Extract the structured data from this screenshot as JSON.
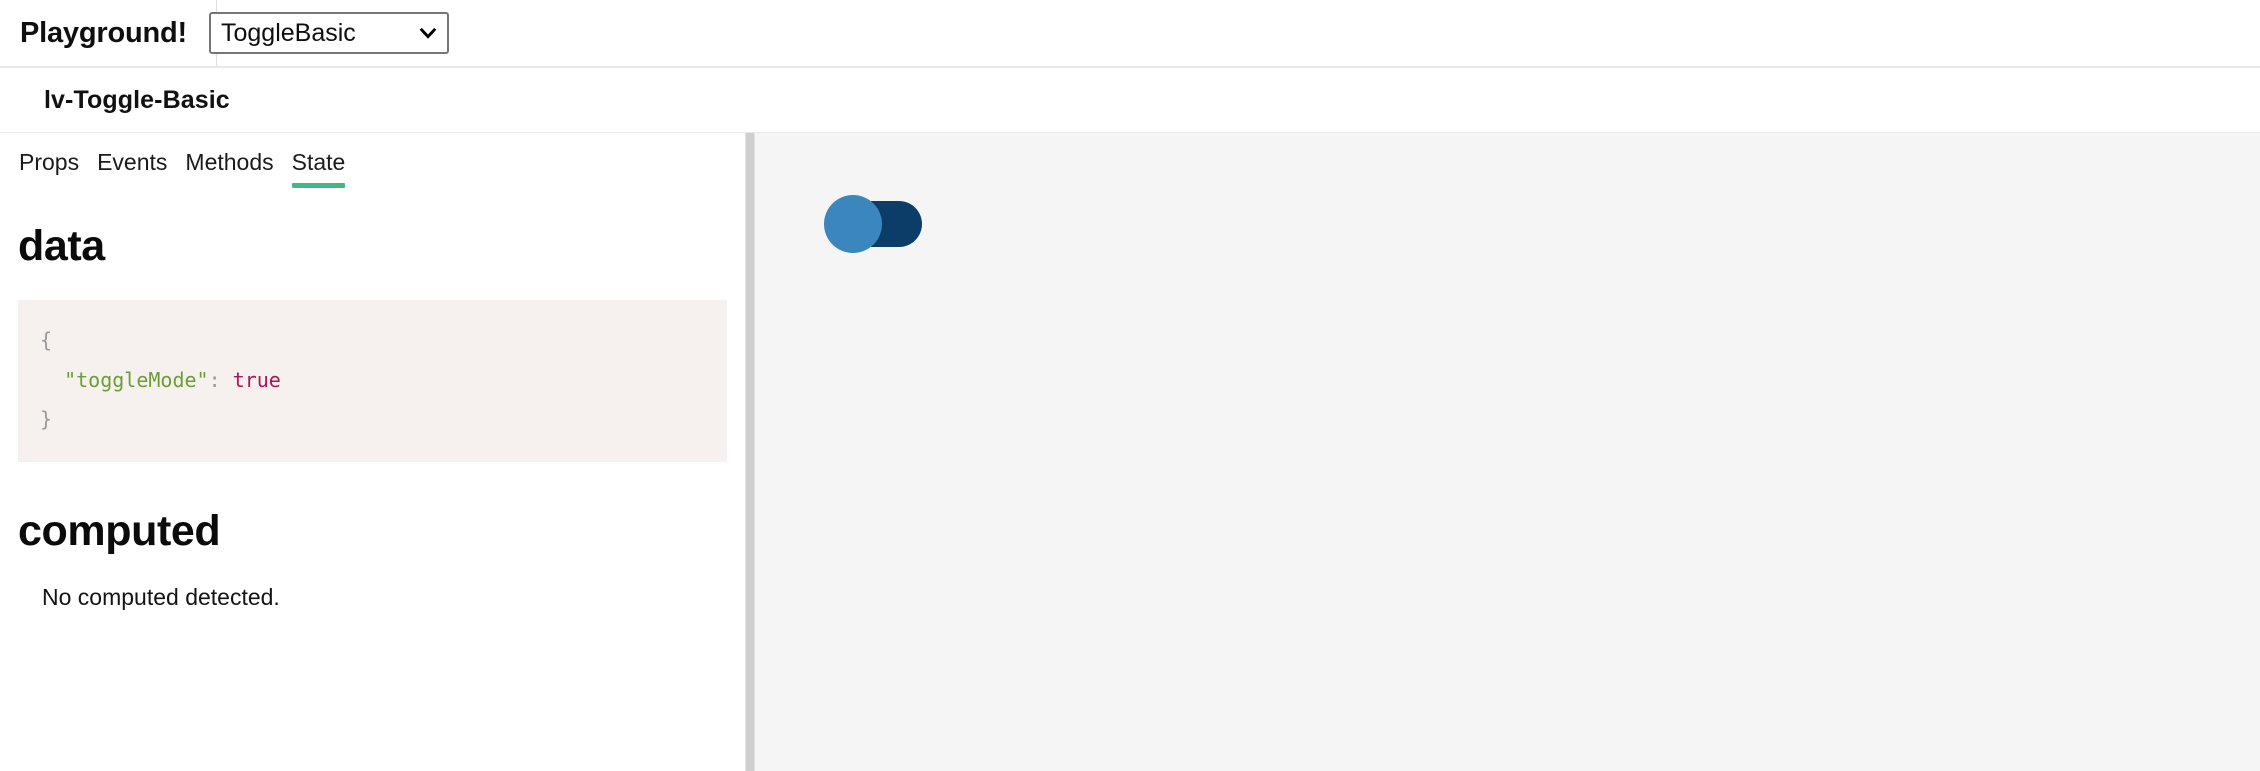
{
  "topbar": {
    "title": "Playground!",
    "component_select": {
      "value": "ToggleBasic",
      "options": [
        "ToggleBasic"
      ],
      "chevron_icon": "chevron-down-icon"
    }
  },
  "subheader": {
    "component_name": "lv-Toggle-Basic"
  },
  "tabs": [
    {
      "label": "Props",
      "active": false
    },
    {
      "label": "Events",
      "active": false
    },
    {
      "label": "Methods",
      "active": false
    },
    {
      "label": "State",
      "active": true
    }
  ],
  "state_panel": {
    "data_heading": "data",
    "data_code": {
      "line_open": "{",
      "key": "\"toggleMode\"",
      "colon": ":",
      "value": "true",
      "line_close": "}"
    },
    "computed_heading": "computed",
    "computed_empty": "No computed detected."
  },
  "preview": {
    "toggle": {
      "name": "lv-toggle",
      "checked": true,
      "knob_position": "left",
      "track_color": "#0b3d68",
      "knob_color": "#3a86bd"
    }
  },
  "colors": {
    "accent_green": "#42b983",
    "code_bg": "#f6f1ee",
    "code_key": "#6a9f35",
    "code_bool": "#ae1457",
    "code_punct": "#9a9a9a",
    "preview_bg": "#f5f5f5",
    "divider": "#cfcfcf"
  }
}
